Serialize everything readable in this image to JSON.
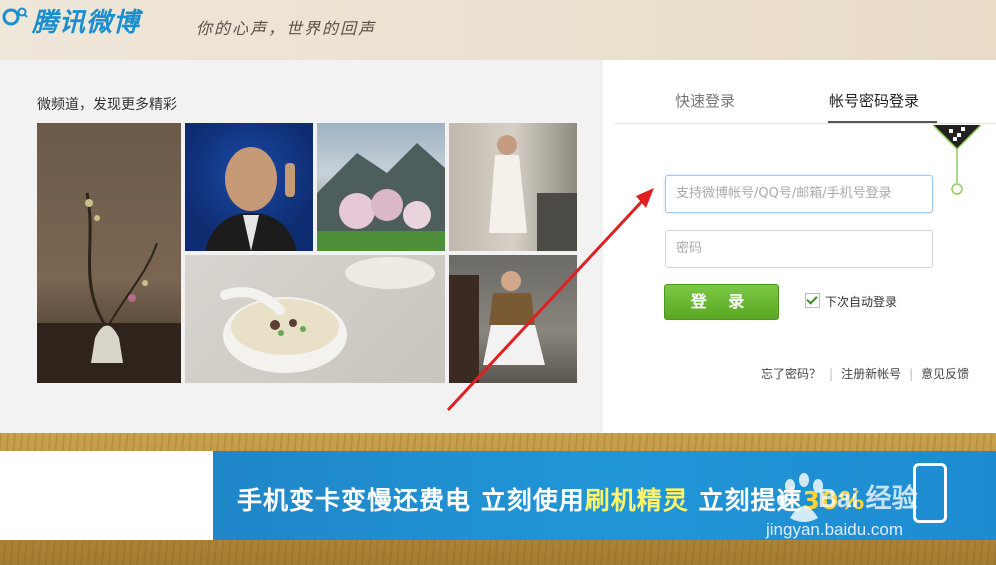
{
  "header": {
    "logo_text": "腾讯微博",
    "slogan": "你的心声，世界的回声"
  },
  "channel": {
    "title": "微频道，发现更多精彩"
  },
  "login": {
    "tabs": [
      "快速登录",
      "帐号密码登录"
    ],
    "active_tab": "帐号密码登录",
    "account_placeholder": "支持微博帐号/QQ号/邮箱/手机号登录",
    "password_placeholder": "密码",
    "login_button": "登 录",
    "auto_login_label": "下次自动登录",
    "auto_login_checked": true,
    "links": [
      "忘了密码？",
      "注册新帐号",
      "意见反馈"
    ]
  },
  "banner": {
    "text_prefix": "手机变卡变慢还费电 立刻使用",
    "text_highlight": "刷机精灵",
    "text_suffix": " 立刻提速",
    "percent": "30%"
  },
  "watermark": {
    "brand": "Bai 经验",
    "url": "jingyan.baidu.com"
  },
  "colors": {
    "brand_blue": "#1a8fd0",
    "login_green": "#5aa724",
    "banner_blue": "#2196d7",
    "arrow_red": "#e02020"
  }
}
